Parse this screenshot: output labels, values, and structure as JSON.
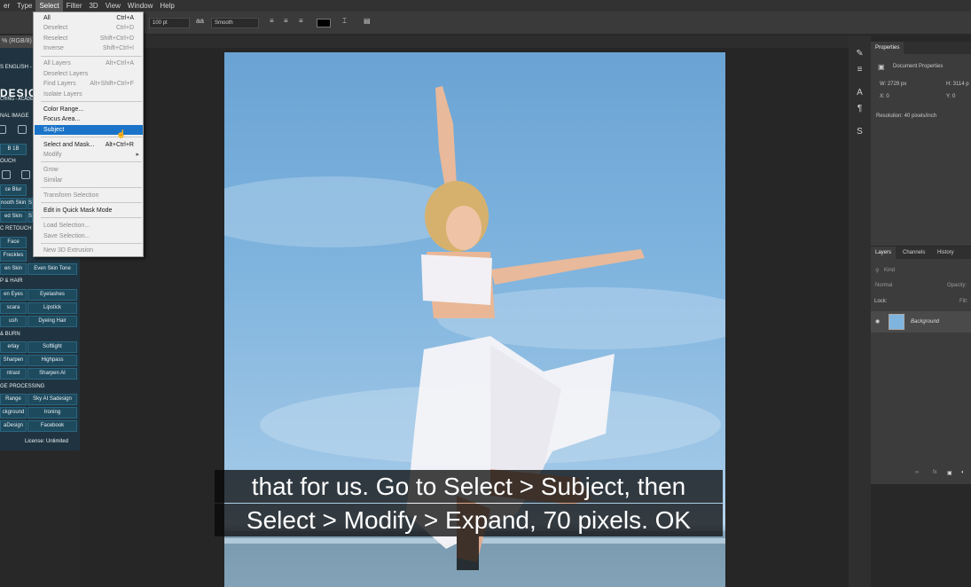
{
  "menubar": {
    "items": [
      "er",
      "Type",
      "Select",
      "Filter",
      "3D",
      "View",
      "Window",
      "Help"
    ]
  },
  "options": {
    "font_size": "100 pt",
    "aa_icon": "aa",
    "antialias": "Smooth"
  },
  "document": {
    "tab_label": "% (RGB/8) *"
  },
  "select_menu": {
    "items": [
      {
        "label": "All",
        "shortcut": "Ctrl+A",
        "enabled": true
      },
      {
        "label": "Deselect",
        "shortcut": "Ctrl+D",
        "enabled": false
      },
      {
        "label": "Reselect",
        "shortcut": "Shift+Ctrl+D",
        "enabled": false
      },
      {
        "label": "Inverse",
        "shortcut": "Shift+Ctrl+I",
        "enabled": false
      },
      {
        "label": "All Layers",
        "shortcut": "Alt+Ctrl+A",
        "enabled": false
      },
      {
        "label": "Deselect Layers",
        "shortcut": "",
        "enabled": false
      },
      {
        "label": "Find Layers",
        "shortcut": "Alt+Shift+Ctrl+F",
        "enabled": false
      },
      {
        "label": "Isolate Layers",
        "shortcut": "",
        "enabled": false
      },
      {
        "label": "Color Range...",
        "shortcut": "",
        "enabled": true
      },
      {
        "label": "Focus Area...",
        "shortcut": "",
        "enabled": true
      },
      {
        "label": "Subject",
        "shortcut": "",
        "enabled": true,
        "highlighted": true
      },
      {
        "label": "Select and Mask...",
        "shortcut": "Alt+Ctrl+R",
        "enabled": true
      },
      {
        "label": "Modify",
        "shortcut": "",
        "enabled": false,
        "submenu": true
      },
      {
        "label": "Grow",
        "shortcut": "",
        "enabled": false
      },
      {
        "label": "Similar",
        "shortcut": "",
        "enabled": false
      },
      {
        "label": "Transform Selection",
        "shortcut": "",
        "enabled": false
      },
      {
        "label": "Edit in Quick Mask Mode",
        "shortcut": "",
        "enabled": true
      },
      {
        "label": "Load Selection...",
        "shortcut": "",
        "enabled": false
      },
      {
        "label": "Save Selection...",
        "shortcut": "",
        "enabled": false
      },
      {
        "label": "New 3D Extrusion",
        "shortcut": "",
        "enabled": false
      }
    ]
  },
  "plugin_panel": {
    "top_label": "S ENGLISH -",
    "logo": "DESIG",
    "logo_sub": "CHING - ACADE",
    "section_image": "NAL IMAGE",
    "btn_b1b": "B 1B",
    "section_touch": "OUCH",
    "section_retouch": "C RETOUCH",
    "section_hair": "P & HAIR",
    "section_burn": "& BURN",
    "section_processing": "GE PROCESSING",
    "rows": [
      [
        "ce Blur",
        ""
      ],
      [
        "nooth Skin",
        "S"
      ],
      [
        "ed Skin",
        "S"
      ],
      [
        "Face",
        ""
      ],
      [
        "Freckles",
        ""
      ],
      [
        "en Skin",
        "Even Skin Tone"
      ],
      [
        "en Eyes",
        "Eyelashes"
      ],
      [
        "scara",
        "Lipstick"
      ],
      [
        "ush",
        "Dyeing Hair"
      ],
      [
        "erlay",
        "Softlight"
      ],
      [
        "Sharpen",
        "Highpass"
      ],
      [
        "ntrast",
        "Sharpen AI"
      ],
      [
        "Range",
        "Sky AI Sadesign"
      ],
      [
        "ckground",
        "Ironing"
      ],
      [
        "aDesign",
        "Facebook"
      ]
    ],
    "license": "License: Unlimited"
  },
  "properties": {
    "tab": "Properties",
    "title": "Document Properties",
    "w": "W:  2729 px",
    "h": "H:  3114 p",
    "x": "X:  0",
    "y": "Y:  0",
    "resolution": "Resolution: 40 pixels/inch"
  },
  "layers": {
    "tabs": [
      "Layers",
      "Channels",
      "History"
    ],
    "kind": "Kind",
    "mode": "Normal",
    "opacity": "Opacity:",
    "lock": "Lock:",
    "fill": "Fill:",
    "layer_name": "Background"
  },
  "caption": {
    "line1": "that for us. Go to Select > Subject, then",
    "line2": "Select > Modify > Expand, 70 pixels. OK"
  },
  "colors": {
    "menu_highlight": "#1a73c8",
    "plugin_bg": "#1f3440",
    "plugin_button": "#1e4a5e"
  }
}
